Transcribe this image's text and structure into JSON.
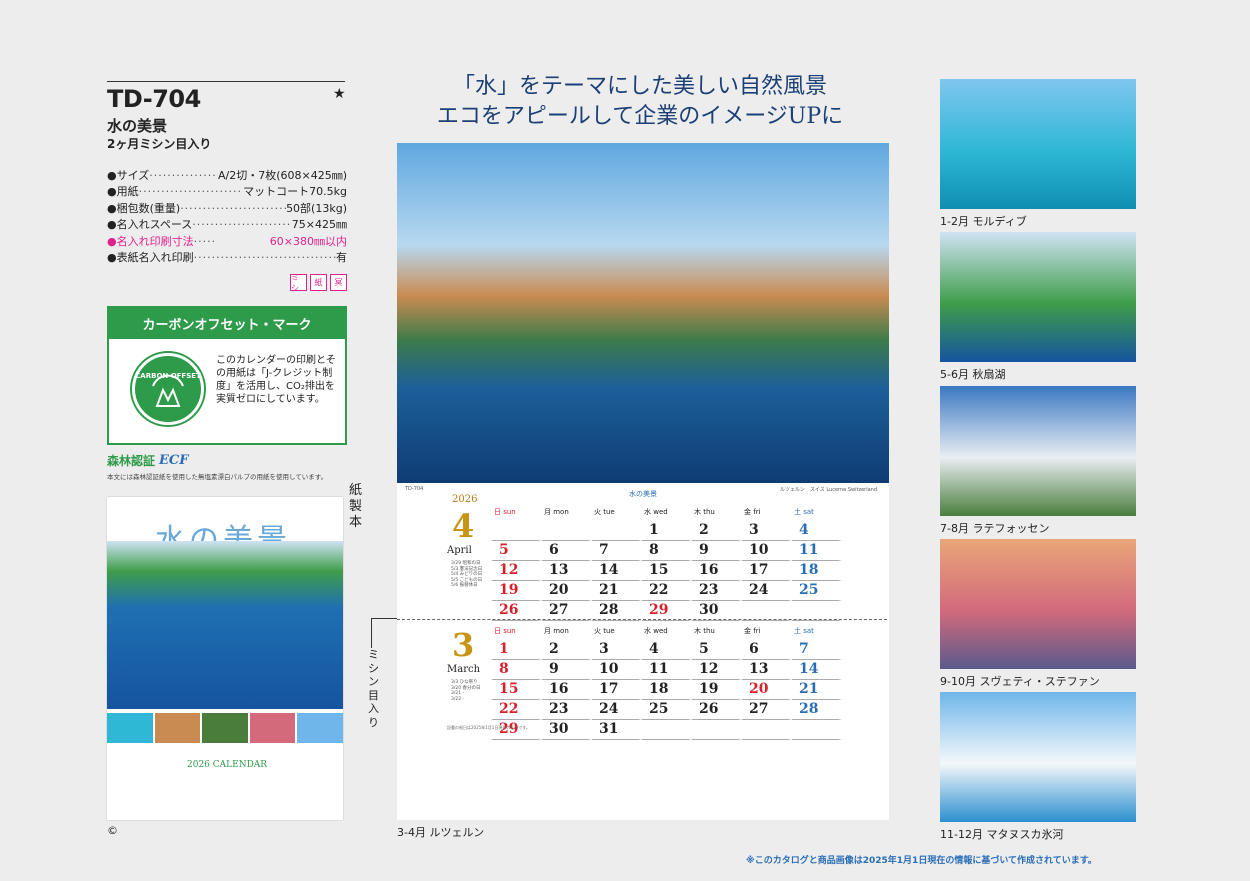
{
  "product": {
    "code": "TD-704",
    "star": "★",
    "name": "水の美景",
    "subtitle": "2ヶ月ミシン目入り",
    "specs": [
      {
        "key": "●サイズ",
        "dots": "·························",
        "value": "A/2切・7枚(608×425㎜)",
        "highlight": false
      },
      {
        "key": "●用紙",
        "dots": "·······························",
        "value": "マットコート70.5kg",
        "highlight": false
      },
      {
        "key": "●梱包数(重量)",
        "dots": "·······························",
        "value": "50部(13kg)",
        "highlight": false
      },
      {
        "key": "●名入れスペース",
        "dots": "·························",
        "value": "75×425㎜",
        "highlight": false
      },
      {
        "key": "●名入れ印刷寸法",
        "dots": "·····",
        "value": "60×380㎜以内",
        "highlight": true
      },
      {
        "key": "●表紙名入れ印刷",
        "dots": "·································",
        "value": "有",
        "highlight": false
      }
    ],
    "chips": [
      "ミシ",
      "紙",
      "冥"
    ],
    "copyright": "©"
  },
  "carbon": {
    "heading": "カーボンオフセット・マーク",
    "logo_text": "CARBON OFFSET",
    "text": "このカレンダーの印刷とその用紙は「J-クレジット制度」を活用し、CO₂排出を実質ゼロにしています。"
  },
  "forest": {
    "mark": "森林認証",
    "ecf": "ECF",
    "note": "本文には森林認証紙を使用した無塩素漂白パルプの用紙を使用しています。"
  },
  "cover": {
    "title": "水の美景",
    "year_label": "2026 CALENDAR",
    "binding": "紙製本"
  },
  "perforation_label": "ミシン目入り",
  "headline": {
    "line1": "「水」をテーマにした美しい自然風景",
    "line2": "エコをアピールして企業のイメージUPに"
  },
  "calendar": {
    "year": "2026",
    "title": "水の美景",
    "photo_caption": "ルツェルン　スイス  Lucerne  Switzerland",
    "photo_credit": "TD-704",
    "weekdays": [
      "日 sun",
      "月 mon",
      "火 tue",
      "水 wed",
      "木 thu",
      "金 fri",
      "土 sat"
    ],
    "months": [
      {
        "number": "4",
        "name": "April",
        "holidays": [
          "3/29 昭和の日",
          "5/3 憲法記念日",
          "5/4 みどりの日",
          "5/5 こどもの日",
          "5/6 振替休日"
        ],
        "days": [
          "",
          "",
          "",
          "1",
          "2",
          "3",
          "4",
          "5",
          "6",
          "7",
          "8",
          "9",
          "10",
          "11",
          "12",
          "13",
          "14",
          "15",
          "16",
          "17",
          "18",
          "19",
          "20",
          "21",
          "22",
          "23",
          "24",
          "25",
          "26",
          "27",
          "28",
          "29",
          "30",
          "",
          ""
        ],
        "red_days": [
          "5",
          "12",
          "19",
          "26",
          "29"
        ]
      },
      {
        "number": "3",
        "name": "March",
        "holidays": [
          "3/3 ひな祭り",
          "3/20 春分の日",
          "3/21 -",
          "3/22 -"
        ],
        "days": [
          "1",
          "2",
          "3",
          "4",
          "5",
          "6",
          "7",
          "8",
          "9",
          "10",
          "11",
          "12",
          "13",
          "14",
          "15",
          "16",
          "17",
          "18",
          "19",
          "20",
          "21",
          "22",
          "23",
          "24",
          "25",
          "26",
          "27",
          "28",
          "29",
          "30",
          "31",
          "",
          "",
          "",
          ""
        ],
        "red_days": [
          "1",
          "8",
          "15",
          "20",
          "22",
          "29"
        ]
      }
    ],
    "note": "記載の祝日は2025年1月1日現在のものです。"
  },
  "main_caption": "3-4月  ルツェルン",
  "thumbnails": [
    {
      "caption": "1-2月  モルディブ",
      "colors": [
        "#7fc7ef",
        "#2fb7d6",
        "#0e8fb2"
      ]
    },
    {
      "caption": "5-6月  秋扇湖",
      "colors": [
        "#cfe3f4",
        "#3f9d4a",
        "#1554a0"
      ]
    },
    {
      "caption": "7-8月  ラテフォッセン",
      "colors": [
        "#3a78c2",
        "#e9eef3",
        "#4a7d3c"
      ]
    },
    {
      "caption": "9-10月  スヴェティ・ステファン",
      "colors": [
        "#e9a678",
        "#d26a7c",
        "#5b5a8c"
      ]
    },
    {
      "caption": "11-12月  マタヌスカ氷河",
      "colors": [
        "#6fb6ea",
        "#f4f8fb",
        "#2b8fcf"
      ]
    }
  ],
  "footnote": "※このカタログと商品画像は2025年1月1日現在の情報に基づいて作成されています。"
}
